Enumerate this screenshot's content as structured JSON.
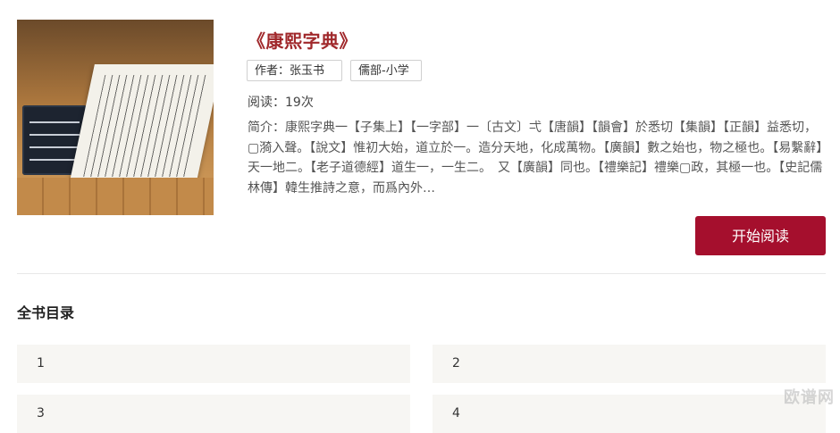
{
  "book": {
    "title": "《康熙字典》",
    "author_tag": "作者：张玉书",
    "category_tag": "儒部-小学",
    "reads": "阅读：19次",
    "intro": "简介：康熙字典一【子集上】【一字部】一〔古文〕弌【唐韻】【韻會】於悉切【集韻】【正韻】益悉切，▢漪入聲。【說文】惟初大始，道立於一。造分天地，化成萬物。【廣韻】數之始也，物之極也。【易繫辭】天一地二。【老子道德經】道生一，一生二。　又【廣韻】同也。【禮樂記】禮樂▢政，其極一也。【史記儒林傳】韓生推詩之意，而爲內外…",
    "read_button": "开始阅读"
  },
  "toc": {
    "heading": "全书目录",
    "items": [
      "1",
      "2",
      "3",
      "4"
    ]
  },
  "watermark": "欧谱网"
}
